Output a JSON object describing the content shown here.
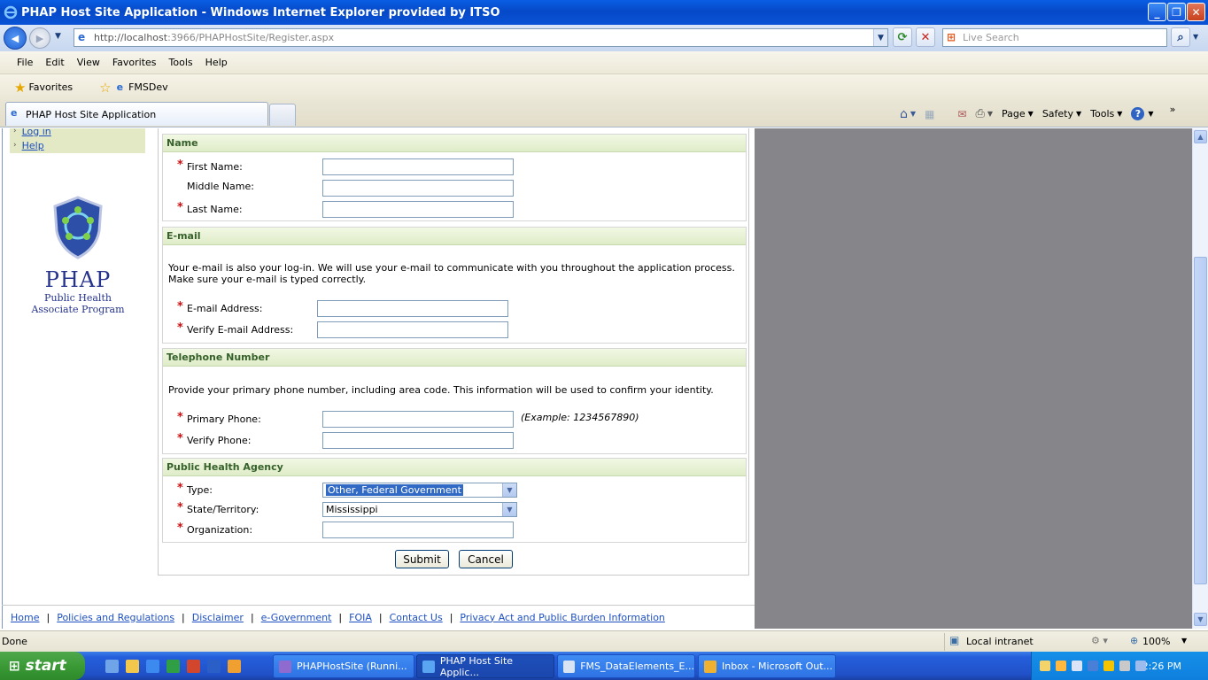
{
  "window": {
    "title": "PHAP Host Site Application - Windows Internet Explorer provided by ITSO"
  },
  "browser": {
    "address_host": "http://localhost",
    "address_path": ":3966/PHAPHostSite/Register.aspx",
    "search_placeholder": "Live Search",
    "menu": [
      "File",
      "Edit",
      "View",
      "Favorites",
      "Tools",
      "Help"
    ],
    "favorites_label": "Favorites",
    "fav_link": "FMSDev",
    "tab_title": "PHAP Host Site Application",
    "commands": {
      "page": "Page",
      "safety": "Safety",
      "tools": "Tools"
    }
  },
  "sidebar": {
    "items": [
      {
        "label": "Log in"
      },
      {
        "label": "Help"
      }
    ],
    "logo": {
      "title": "PHAP",
      "line1": "Public Health",
      "line2": "Associate Program"
    }
  },
  "form": {
    "name_section": {
      "title": "Name",
      "first": "First Name:",
      "middle": "Middle Name:",
      "last": "Last Name:"
    },
    "email_section": {
      "title": "E-mail",
      "desc": "Your e-mail is also your log-in. We will use your e-mail to communicate with you throughout the application process. Make sure your e-mail is typed correctly.",
      "address": "E-mail Address:",
      "verify": "Verify E-mail Address:"
    },
    "phone_section": {
      "title": "Telephone Number",
      "desc": "Provide your primary phone number, including area code. This information will be used to confirm your identity.",
      "primary": "Primary Phone:",
      "verify": "Verify Phone:",
      "example": "(Example: 1234567890)"
    },
    "agency_section": {
      "title": "Public Health Agency",
      "type_label": "Type:",
      "type_value": "Other, Federal Government",
      "state_label": "State/Territory:",
      "state_value": "Mississippi",
      "org_label": "Organization:"
    },
    "required_marker": "*",
    "submit": "Submit",
    "cancel": "Cancel"
  },
  "footer": {
    "links": [
      "Home",
      "Policies and Regulations",
      "Disclaimer",
      "e-Government",
      "FOIA",
      "Contact Us",
      "Privacy Act and Public Burden Information"
    ],
    "separator": "|"
  },
  "status": {
    "text": "Done",
    "zone": "Local intranet",
    "zoom": "100%"
  },
  "taskbar": {
    "start": "start",
    "buttons": [
      "PHAPHostSite (Runni...",
      "PHAP Host Site Applic...",
      "FMS_DataElements_E...",
      "Inbox - Microsoft Out..."
    ],
    "clock": "2:26 PM"
  }
}
